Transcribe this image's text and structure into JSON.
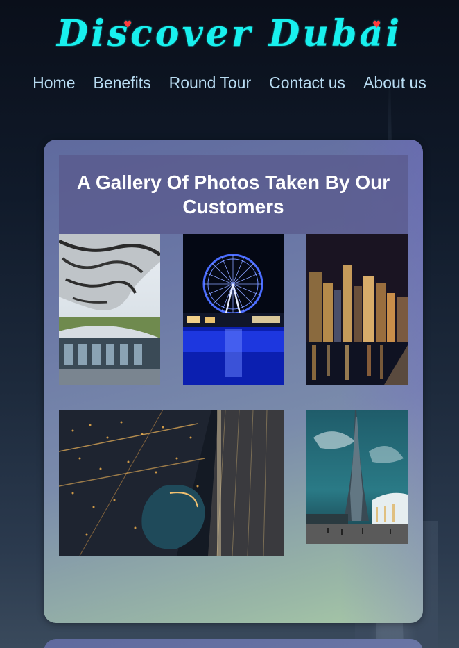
{
  "brand": {
    "title": "Discover Dubai"
  },
  "nav": {
    "items": [
      {
        "label": "Home"
      },
      {
        "label": "Benefits"
      },
      {
        "label": "Round Tour"
      },
      {
        "label": "Contact us"
      },
      {
        "label": "About us"
      }
    ]
  },
  "gallery": {
    "title": "A Gallery Of Photos Taken By Our Customers",
    "photos": [
      {
        "subject": "museum-of-the-future-photo"
      },
      {
        "subject": "ain-dubai-ferris-wheel-photo"
      },
      {
        "subject": "dubai-marina-skyline-photo"
      },
      {
        "subject": "downtown-dubai-aerial-photo"
      },
      {
        "subject": "burj-khalifa-photo"
      }
    ]
  },
  "colors": {
    "brand": "#18f0ee",
    "heart": "#ff3b3b",
    "nav_text": "#b9dcf2",
    "title_text": "#ffffff"
  }
}
